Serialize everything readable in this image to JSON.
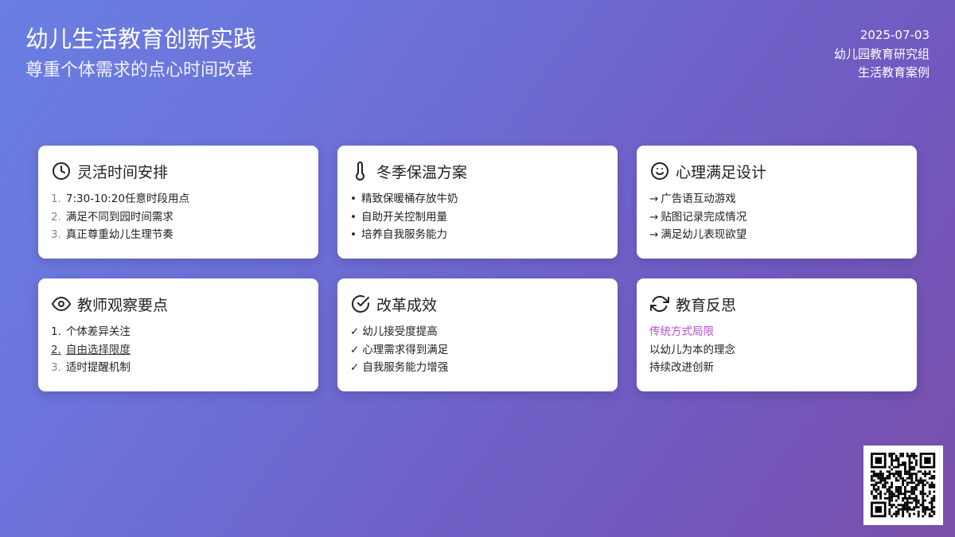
{
  "header": {
    "title": "幼儿生活教育创新实践",
    "subtitle": "尊重个体需求的点心时间改革",
    "date": "2025-07-03",
    "author": "幼儿园教育研究组",
    "category": "生活教育案例"
  },
  "cards": [
    {
      "icon": "clock-icon",
      "title": "灵活时间安排",
      "items": [
        {
          "num": "1.",
          "text": "7:30-10:20任意时段用点"
        },
        {
          "num": "2.",
          "text": "满足不同到园时间需求"
        },
        {
          "num": "3.",
          "text": "真正尊重幼儿生理节奏"
        }
      ]
    },
    {
      "icon": "thermometer-icon",
      "title": "冬季保温方案",
      "items": [
        {
          "num": "•",
          "text": "精致保暖桶存放牛奶"
        },
        {
          "num": "•",
          "text": "自助开关控制用量"
        },
        {
          "num": "•",
          "text": "培养自我服务能力"
        }
      ]
    },
    {
      "icon": "smiley-icon",
      "title": "心理满足设计",
      "items": [
        {
          "num": "→",
          "text": "广告语互动游戏"
        },
        {
          "num": "→",
          "text": "贴图记录完成情况"
        },
        {
          "num": "→",
          "text": "满足幼儿表现欲望"
        }
      ]
    },
    {
      "icon": "eye-icon",
      "title": "教师观察要点",
      "items": [
        {
          "num": "1.",
          "text": "个体差异关注"
        },
        {
          "num": "2.",
          "text": "自由选择限度"
        },
        {
          "num": "3.",
          "text": "适时提醒机制"
        }
      ]
    },
    {
      "icon": "check-circle-icon",
      "title": "改革成效",
      "items": [
        {
          "num": "✓",
          "text": "幼儿接受度提高"
        },
        {
          "num": "✓",
          "text": "心理需求得到满足"
        },
        {
          "num": "✓",
          "text": "自我服务能力增强"
        }
      ]
    },
    {
      "icon": "refresh-icon",
      "title": "教育反思",
      "items": [
        {
          "text": "传统方式局限"
        },
        {
          "text": "以幼儿为本的理念"
        },
        {
          "text": "持续改进创新"
        }
      ]
    }
  ],
  "colors": {
    "gradient_start": "#6a7fe3",
    "gradient_end": "#7a4fa9",
    "accent": "#b14fd8"
  },
  "qr_icon": "qr-code"
}
